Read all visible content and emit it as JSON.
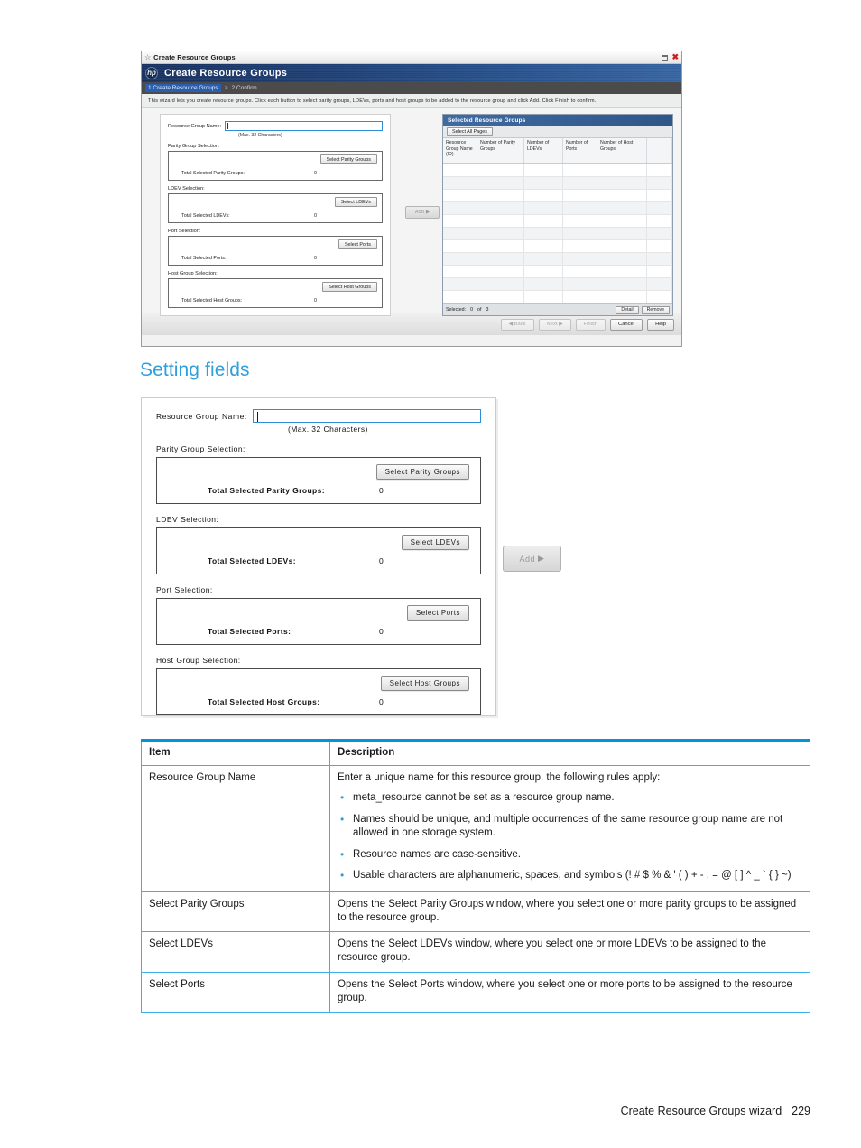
{
  "figure_wizard": {
    "window_title": "Create Resource Groups",
    "window_icon": "wizard-icon",
    "maximize_icon": "maximize-icon",
    "close_icon": "close-icon",
    "banner_title": "Create Resource Groups",
    "logo_text": "hp",
    "breadcrumb": {
      "step1": "1.Create Resource Groups",
      "separator": ">",
      "step2": "2.Confirm"
    },
    "description": "This wizard lets you create resource groups. Click each button to select parity groups, LDEVs, ports and host groups to be added to the resource group and click Add. Click Finish to confirm.",
    "form": {
      "name_label": "Resource Group Name:",
      "name_value": "",
      "max_chars": "(Max. 32 Characters)",
      "sections": [
        {
          "label": "Parity Group Selection:",
          "button": "Select Parity Groups",
          "total_label": "Total Selected Parity Groups:",
          "total_value": "0"
        },
        {
          "label": "LDEV Selection:",
          "button": "Select LDEVs",
          "total_label": "Total Selected LDEVs:",
          "total_value": "0"
        },
        {
          "label": "Port Selection:",
          "button": "Select Ports",
          "total_label": "Total Selected Ports:",
          "total_value": "0"
        },
        {
          "label": "Host Group Selection:",
          "button": "Select Host Groups",
          "total_label": "Total Selected Host Groups:",
          "total_value": "0"
        }
      ]
    },
    "add_button": "Add",
    "add_button_arrow": "▶",
    "selected_panel": {
      "title": "Selected Resource Groups",
      "select_all_pages": "Select All Pages",
      "columns": [
        "Resource Group Name (ID)",
        "Number of Parity Groups",
        "Number of LDEVs",
        "Number of Ports",
        "Number of Host Groups"
      ],
      "status_selected_label": "Selected:",
      "status_selected_value": "0",
      "status_of_label": "of",
      "status_total_value": "3",
      "detail_button": "Detail",
      "remove_button": "Remove"
    },
    "footer_buttons": {
      "back": "◀ Back",
      "next": "Next ▶",
      "finish": "Finish",
      "cancel": "Cancel",
      "help": "Help"
    }
  },
  "heading": "Setting fields",
  "figure_form": {
    "name_label": "Resource Group Name:",
    "name_value": "",
    "max_chars": "(Max. 32 Characters)",
    "sections": [
      {
        "label": "Parity Group Selection:",
        "button": "Select Parity Groups",
        "total_label": "Total Selected Parity Groups:",
        "total_value": "0"
      },
      {
        "label": "LDEV Selection:",
        "button": "Select LDEVs",
        "total_label": "Total Selected LDEVs:",
        "total_value": "0"
      },
      {
        "label": "Port Selection:",
        "button": "Select Ports",
        "total_label": "Total Selected Ports:",
        "total_value": "0"
      },
      {
        "label": "Host Group Selection:",
        "button": "Select Host Groups",
        "total_label": "Total Selected Host Groups:",
        "total_value": "0"
      }
    ],
    "add_button": "Add",
    "add_button_arrow": "▶"
  },
  "table": {
    "headers": [
      "Item",
      "Description"
    ],
    "rows": [
      {
        "item": "Resource Group Name",
        "lead": "Enter a unique name for this resource group. the following rules apply:",
        "bullets": [
          "meta_resource cannot be set as a resource group name.",
          "Names should be unique, and multiple occurrences of the same resource group name are not allowed in one storage system.",
          "Resource names are case-sensitive.",
          "Usable characters are alphanumeric, spaces, and symbols (! # $ % & ' ( ) + - . = @ [ ] ^ _ ` { } ~)"
        ]
      },
      {
        "item": "Select Parity Groups",
        "lead": "Opens the Select Parity Groups window, where you select one or more parity groups to be assigned to the resource group.",
        "bullets": []
      },
      {
        "item": "Select LDEVs",
        "lead": "Opens the Select LDEVs window, where you select one or more LDEVs to be assigned to the resource group.",
        "bullets": []
      },
      {
        "item": "Select Ports",
        "lead": "Opens the Select Ports window, where you select one or more ports to be assigned to the resource group.",
        "bullets": []
      }
    ]
  },
  "footer": {
    "chapter": "Create Resource Groups wizard",
    "page_number": "229"
  },
  "colors": {
    "accent_blue": "#0096d6",
    "heading_blue": "#2f9fdc",
    "table_border": "#3ab0e5",
    "banner_navy": "#1d3e74"
  }
}
